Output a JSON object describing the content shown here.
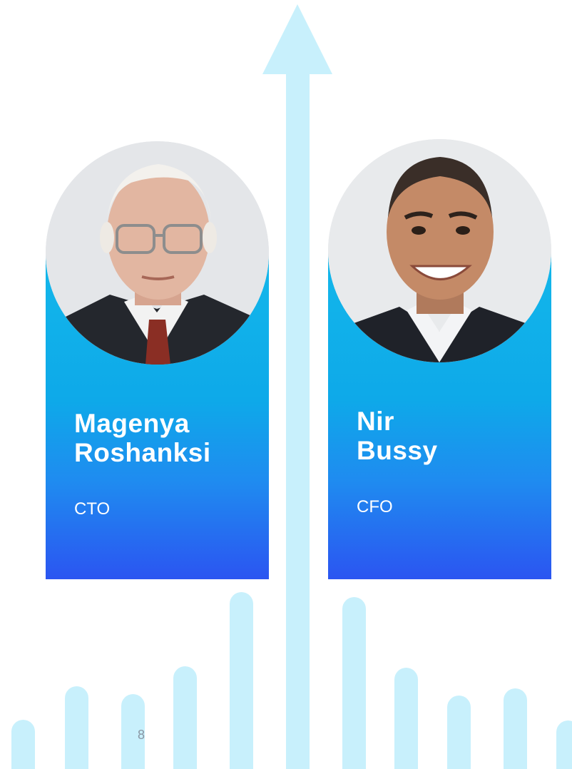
{
  "page": {
    "number": "8"
  },
  "decor": {
    "bar_color": "#c8f0fc",
    "arrow_icon": "arrow-up-icon"
  },
  "team": [
    {
      "name": "Magenya\nRoshanksi",
      "role": "CTO",
      "photo": "portrait-older-man-glasses"
    },
    {
      "name": "Nir\nBussy",
      "role": "CFO",
      "photo": "portrait-smiling-man"
    }
  ],
  "colors": {
    "card_top": "#13b7ea",
    "card_bottom": "#2b55f1",
    "text": "#ffffff"
  }
}
